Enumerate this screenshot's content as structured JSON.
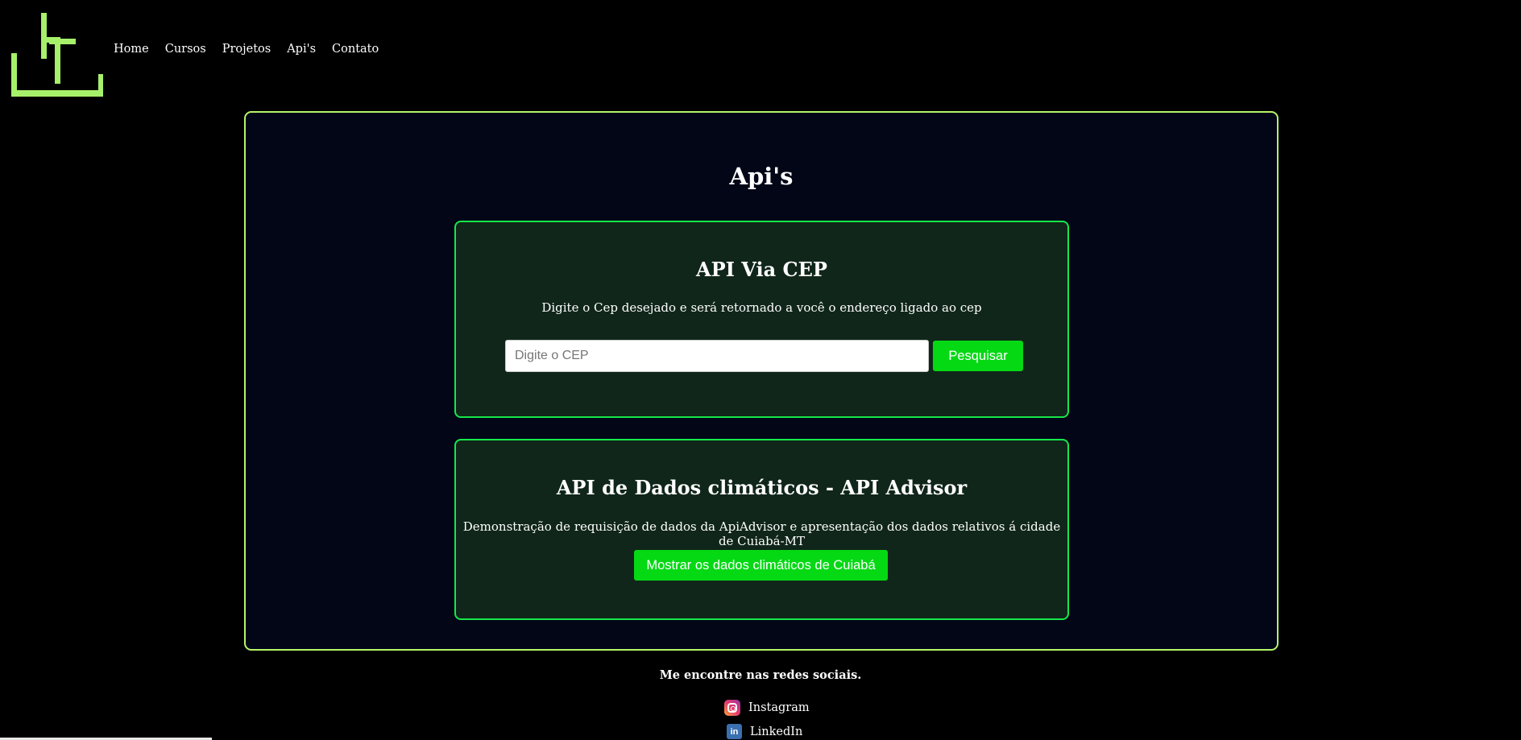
{
  "nav": {
    "items": [
      {
        "label": "Home"
      },
      {
        "label": "Cursos"
      },
      {
        "label": "Projetos"
      },
      {
        "label": "Api's"
      },
      {
        "label": "Contato"
      }
    ]
  },
  "page": {
    "title": "Api's"
  },
  "cep_card": {
    "title": "API Via CEP",
    "description": "Digite o Cep desejado e será retornado a você o endereço ligado ao cep",
    "input_placeholder": "Digite o CEP",
    "input_value": "",
    "button_label": "Pesquisar"
  },
  "clima_card": {
    "title": "API de Dados climáticos - API Advisor",
    "description": "Demonstração de requisição de dados da ApiAdvisor e apresentação dos dados relativos á cidade de Cuiabá-MT",
    "button_label": "Mostrar os dados climáticos de Cuiabá"
  },
  "footer": {
    "title": "Me encontre nas redes sociais.",
    "links": [
      {
        "label": "Instagram",
        "icon": "instagram-icon"
      },
      {
        "label": "LinkedIn",
        "icon": "linkedin-icon"
      }
    ]
  },
  "colors": {
    "background": "#000000",
    "panel_bg": "#020617",
    "panel_border": "#b5f56a",
    "card_bg": "#10261a",
    "card_border": "#15e84a",
    "button_bg": "#05d914",
    "logo": "#b5f56a"
  }
}
